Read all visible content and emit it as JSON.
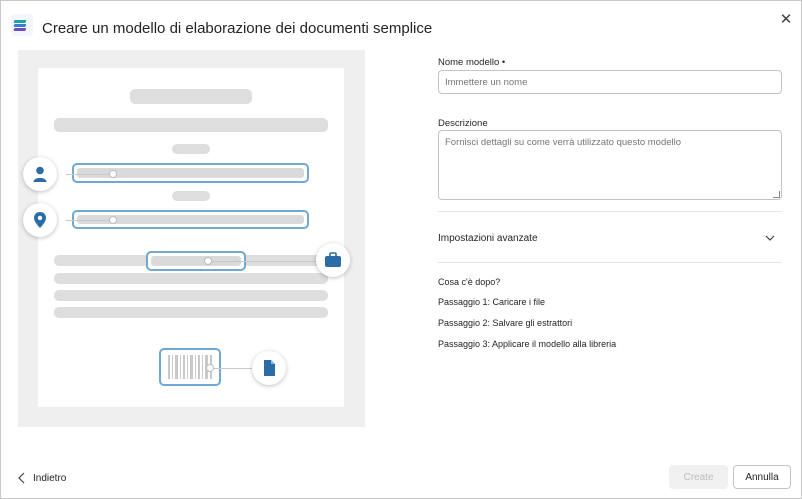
{
  "header": {
    "title": "Creare un modello di elaborazione dei documenti semplice",
    "close_icon": "close-icon",
    "app_icon": "document-model-icon"
  },
  "form": {
    "name_label": "Nome modello •",
    "name_placeholder": "Immettere un nome",
    "name_value": "",
    "description_label": "Descrizione",
    "description_placeholder": "Fornisci dettagli su come verrà utilizzato questo modello",
    "description_value": "",
    "advanced_label": "Impostazioni avanzate",
    "next_heading": "Cosa c'è dopo?",
    "steps": [
      "Passaggio 1: Caricare i file",
      "Passaggio 2: Salvare gli estrattori",
      "Passaggio 3: Applicare il modello alla libreria"
    ]
  },
  "illustration": {
    "icons": [
      "person-icon",
      "location-pin-icon",
      "briefcase-icon",
      "file-icon"
    ],
    "accent_color": "#2b6ca6",
    "highlight_color": "#6fa8d4"
  },
  "footer": {
    "back_label": "Indietro",
    "create_label": "Create",
    "cancel_label": "Annulla"
  }
}
